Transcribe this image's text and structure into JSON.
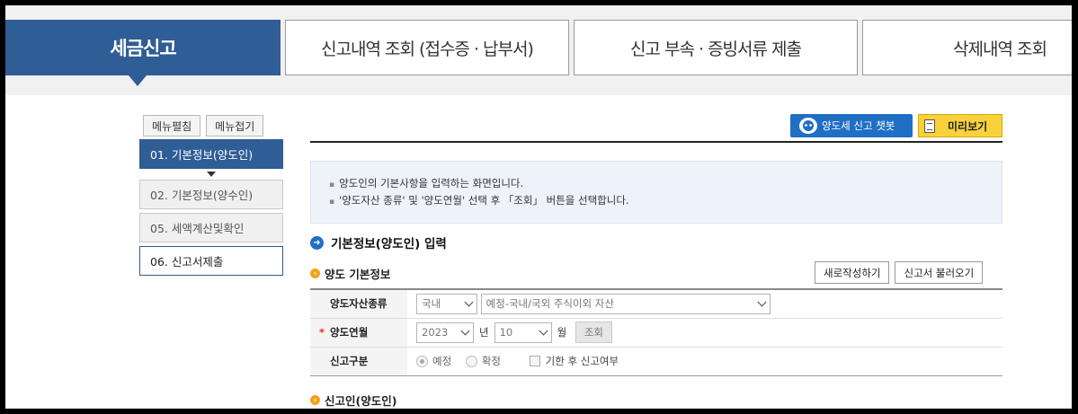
{
  "tabs": {
    "active": "세금신고",
    "items": [
      "신고내역 조회 (접수증 · 납부서)",
      "신고 부속 · 증빙서류 제출",
      "삭제내역 조회"
    ]
  },
  "menu": {
    "expand": "메뉴펼침",
    "collapse": "메뉴접기",
    "items": [
      "01. 기본정보(양도인)",
      "02. 기본정보(양수인)",
      "05. 세액계산및확인",
      "06. 신고서제출"
    ]
  },
  "toolbar": {
    "chatbot": "양도세 신고 챗봇",
    "preview": "미리보기"
  },
  "info": [
    "양도인의 기본사항을 입력하는 화면입니다.",
    "'양도자산 종류' 및 '양도연월' 선택 후 「조회」 버튼을 선택합니다."
  ],
  "section": {
    "title": "기본정보(양도인) 입력",
    "sub1": "양도 기본정보",
    "sub2": "신고인(양도인)",
    "new_btn": "새로작성하기",
    "load_btn": "신고서 불러오기"
  },
  "form": {
    "asset_label": "양도자산종류",
    "asset_region": "국내",
    "asset_type": "예정-국내/국외 주식이외 자산",
    "date_label": "양도연월",
    "required_mark": "*",
    "year": "2023",
    "year_unit": "년",
    "month": "10",
    "month_unit": "월",
    "search_btn": "조회",
    "type_label": "신고구분",
    "radio1": "예정",
    "radio2": "확정",
    "check1": "기한 후 신고여부"
  },
  "colors": {
    "brand": "#2f5d96",
    "chatbot": "#1f6fc4",
    "preview": "#f9d23b",
    "bullet": "#f0a21c"
  }
}
